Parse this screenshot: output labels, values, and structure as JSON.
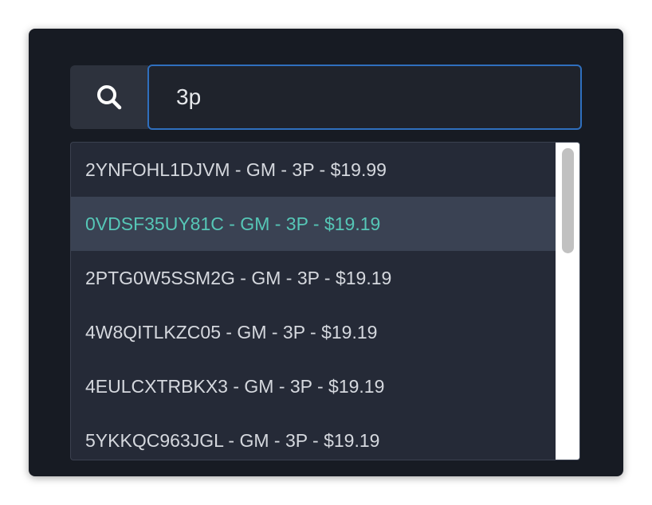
{
  "search": {
    "query": "3p",
    "icon": "search-icon"
  },
  "results": [
    {
      "label": "2YNFOHL1DJVM - GM - 3P - $19.99",
      "active": false
    },
    {
      "label": "0VDSF35UY81C - GM - 3P - $19.19",
      "active": true
    },
    {
      "label": "2PTG0W5SSM2G - GM - 3P - $19.19",
      "active": false
    },
    {
      "label": "4W8QITLKZC05 - GM - 3P - $19.19",
      "active": false
    },
    {
      "label": "4EULCXTRBKX3 - GM - 3P - $19.19",
      "active": false
    },
    {
      "label": "5YKKQC963JGL - GM - 3P - $19.19",
      "active": false
    }
  ],
  "colors": {
    "panel_bg": "#171b23",
    "input_border": "#2f6fbe",
    "active_text": "#56c7b7",
    "active_bg": "#3a4253"
  }
}
